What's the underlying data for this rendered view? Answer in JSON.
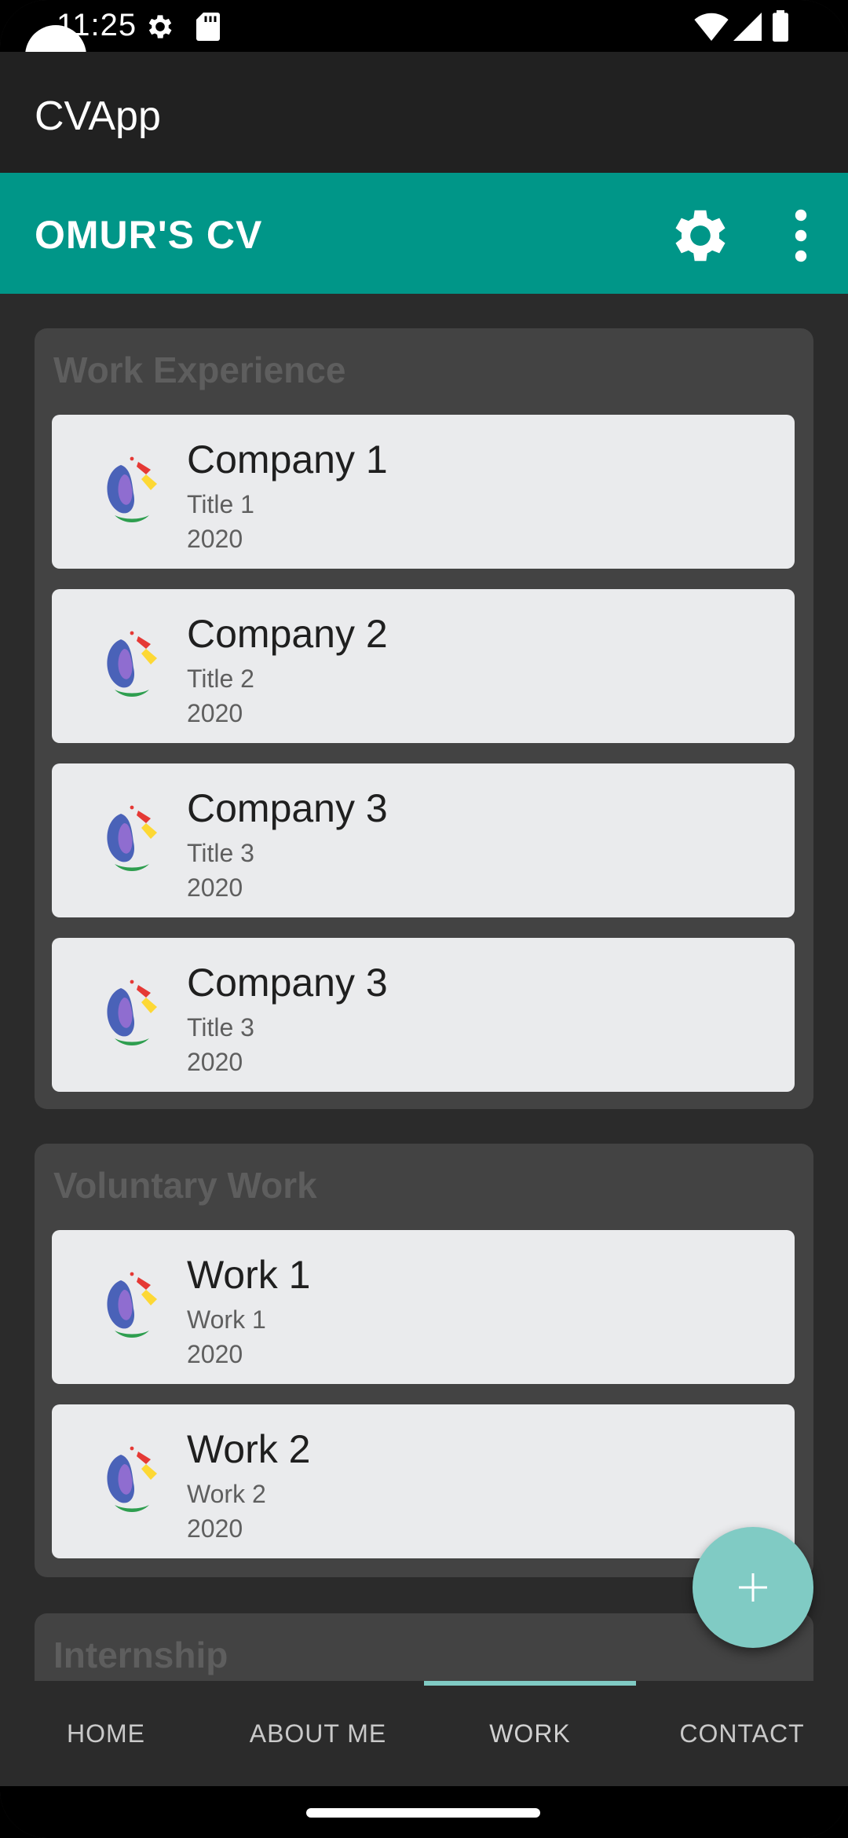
{
  "status_bar": {
    "time": "11:25",
    "icons": [
      "gear-icon",
      "sd-card-icon",
      "wifi-icon",
      "signal-icon",
      "battery-icon"
    ]
  },
  "app": {
    "title": "CVApp"
  },
  "toolbar": {
    "title": "OMUR'S CV",
    "settings_icon": "settings-icon",
    "more_icon": "more-vert-icon"
  },
  "sections": [
    {
      "title": "Work Experience",
      "items": [
        {
          "title": "Company 1",
          "subtitle": "Title 1",
          "year": "2020"
        },
        {
          "title": "Company 2",
          "subtitle": "Title 2",
          "year": "2020"
        },
        {
          "title": "Company 3",
          "subtitle": "Title 3",
          "year": "2020"
        },
        {
          "title": "Company 3",
          "subtitle": "Title 3",
          "year": "2020"
        }
      ]
    },
    {
      "title": "Voluntary Work",
      "items": [
        {
          "title": "Work 1",
          "subtitle": "Work 1",
          "year": "2020"
        },
        {
          "title": "Work 2",
          "subtitle": "Work 2",
          "year": "2020"
        }
      ]
    },
    {
      "title": "Internship",
      "items": []
    }
  ],
  "fab": {
    "icon": "add-icon"
  },
  "bottom_nav": {
    "items": [
      "HOME",
      "ABOUT ME",
      "WORK",
      "CONTACT"
    ],
    "active": "WORK"
  },
  "colors": {
    "primary": "#009688",
    "accent": "#80cbc4",
    "app_bar": "#212121",
    "background": "#2b2b2b",
    "section": "#434343",
    "card": "#eaebed"
  }
}
